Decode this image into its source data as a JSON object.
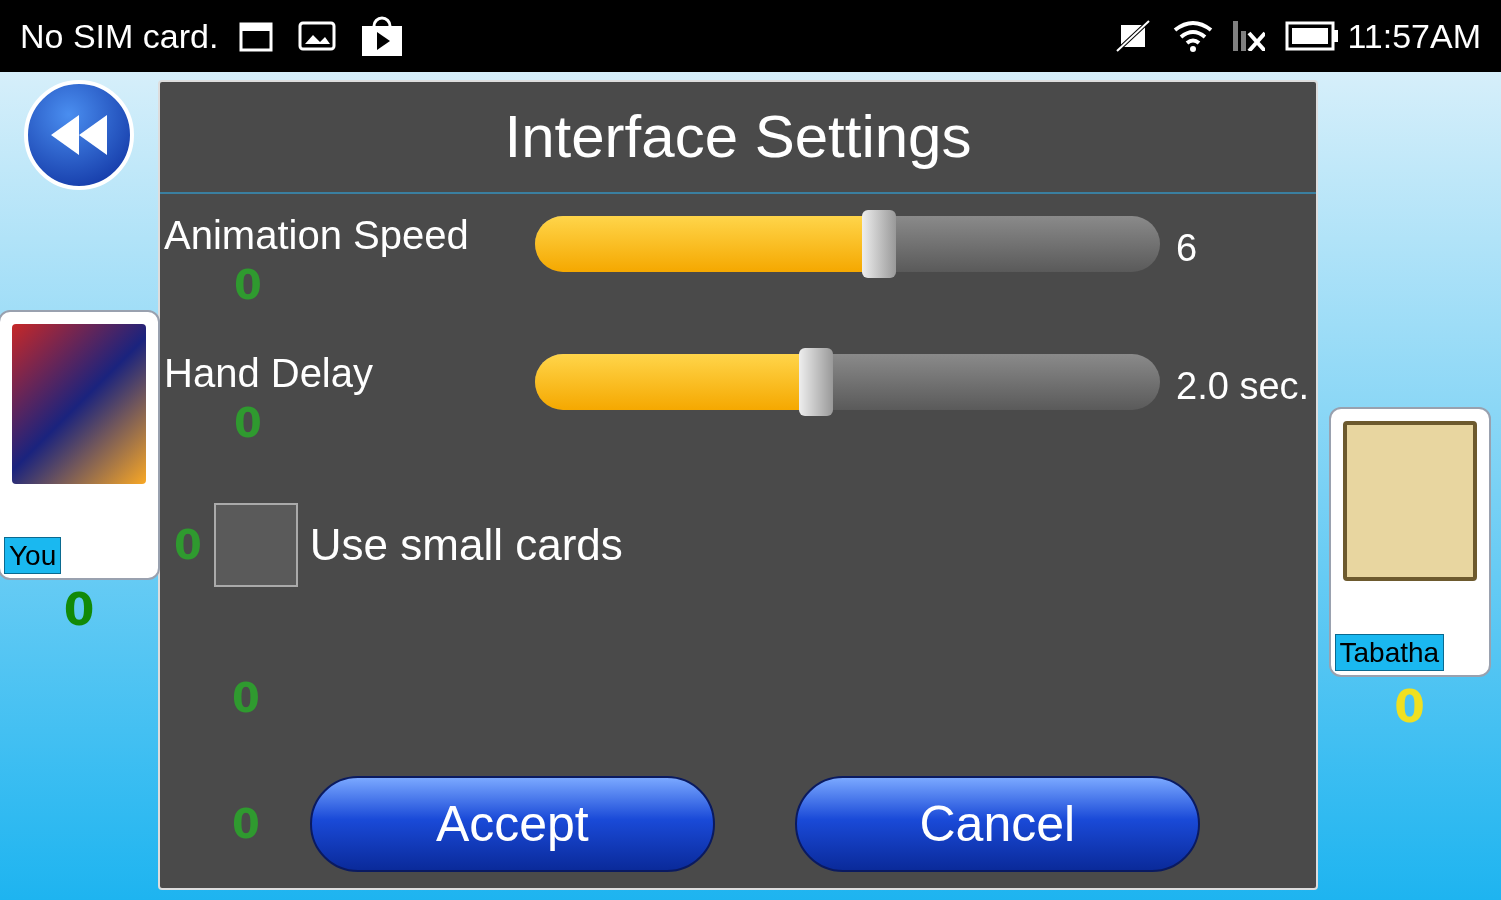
{
  "status_bar": {
    "carrier": "No SIM card.",
    "time": "11:57AM"
  },
  "players": [
    {
      "name": "You",
      "score": "0"
    },
    {
      "name": "Tabatha",
      "score": "0"
    }
  ],
  "dialog": {
    "title": "Interface Settings",
    "sliders": [
      {
        "label": "Animation Speed",
        "level": 0.55,
        "reading": "6"
      },
      {
        "label": "Hand Delay",
        "level": 0.45,
        "reading": "2.0 sec."
      }
    ],
    "checkboxes": [
      {
        "label": "Use small cards",
        "checked": false
      }
    ],
    "pile_counts": [
      "0",
      "0",
      "0",
      "0",
      "0"
    ],
    "buttons": [
      "Accept",
      "Cancel"
    ]
  }
}
